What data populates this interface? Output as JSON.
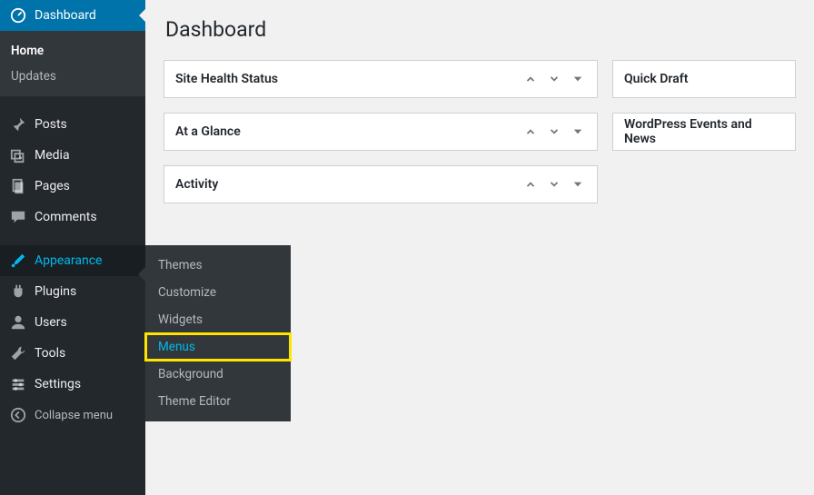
{
  "page": {
    "title": "Dashboard"
  },
  "sidebar": {
    "dashboard": "Dashboard",
    "home": "Home",
    "updates": "Updates",
    "posts": "Posts",
    "media": "Media",
    "pages": "Pages",
    "comments": "Comments",
    "appearance": "Appearance",
    "plugins": "Plugins",
    "users": "Users",
    "tools": "Tools",
    "settings": "Settings",
    "collapse": "Collapse menu"
  },
  "flyout": {
    "themes": "Themes",
    "customize": "Customize",
    "widgets": "Widgets",
    "menus": "Menus",
    "background": "Background",
    "theme_editor": "Theme Editor"
  },
  "boxes": {
    "site_health": "Site Health Status",
    "at_a_glance": "At a Glance",
    "activity": "Activity",
    "quick_draft": "Quick Draft",
    "events": "WordPress Events and News"
  }
}
